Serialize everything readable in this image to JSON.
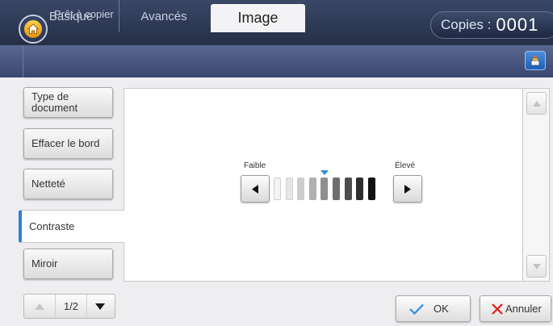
{
  "status": {
    "text": "Prêt à copier"
  },
  "copies": {
    "label": "Copies :",
    "value": "0001"
  },
  "tabs": [
    {
      "label": "Basique"
    },
    {
      "label": "Avancés"
    },
    {
      "label": "Image"
    }
  ],
  "options": [
    {
      "label": "Type de document"
    },
    {
      "label": "Effacer le bord"
    },
    {
      "label": "Netteté"
    },
    {
      "label": "Contraste"
    },
    {
      "label": "Miroir"
    }
  ],
  "contrast": {
    "low_label": "Faible",
    "high_label": "Élevé",
    "level": 4,
    "segments": 9,
    "segment_colors": [
      "#f4f4f4",
      "#e6e6e6",
      "#cdcdcd",
      "#b0b0b0",
      "#8f8f8f",
      "#6e6e6e",
      "#4d4d4d",
      "#2e2e2e",
      "#121212"
    ],
    "marker_color": "#2f8ee0"
  },
  "pager": {
    "text": "1/2"
  },
  "actions": {
    "ok": "OK",
    "cancel": "Annuler"
  },
  "colors": {
    "accent": "#2f7fd8",
    "topbar": "#2a3550",
    "cancel_x": "#e0201a",
    "ok_check": "#2f8ee0"
  }
}
